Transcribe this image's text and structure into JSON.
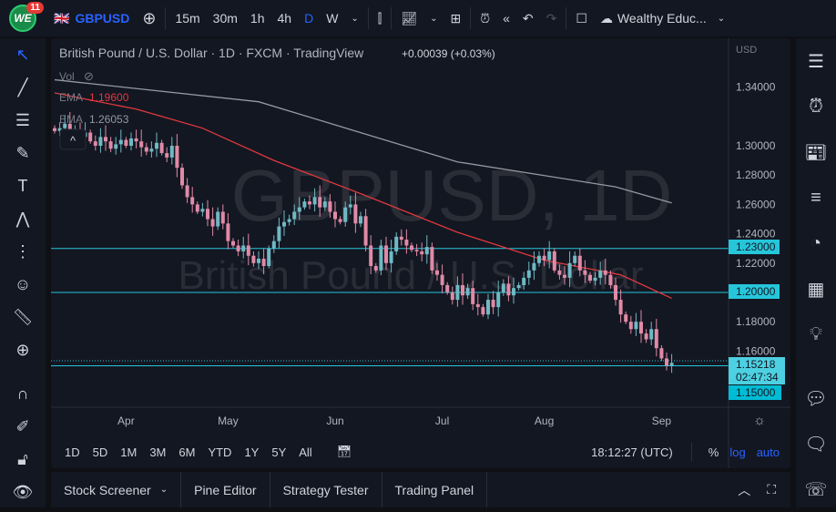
{
  "topbar": {
    "badge": "11",
    "logo": "WE",
    "symbol": "GBPUSD",
    "intervals": [
      "15m",
      "30m",
      "1h",
      "4h",
      "D",
      "W"
    ],
    "active_interval": "D",
    "account": "Wealthy Educ..."
  },
  "legend": {
    "title": "British Pound / U.S. Dollar · 1D · FXCM · TradingView",
    "change": "+0.00039 (+0.03%)",
    "vol": "Vol",
    "ema1_label": "EMA",
    "ema1_value": "1.19600",
    "ema2_label": "EMA",
    "ema2_value": "1.26053"
  },
  "watermark": {
    "line1": "GBPUSD, 1D",
    "line2": "British Pound / U.S. Dollar"
  },
  "price_axis": {
    "currency": "USD",
    "ticks": [
      "1.34000",
      "1.30000",
      "1.28000",
      "1.26000",
      "1.24000",
      "1.22000",
      "1.18000",
      "1.16000"
    ],
    "labels": {
      "line_1": "1.23000",
      "line_2": "1.20000",
      "price": "1.15218",
      "countdown": "02:47:34",
      "line_3": "1.15000"
    }
  },
  "time_axis": {
    "labels": [
      "Apr",
      "May",
      "Jun",
      "Jul",
      "Aug",
      "Sep"
    ]
  },
  "range_bar": {
    "ranges": [
      "1D",
      "5D",
      "1M",
      "3M",
      "6M",
      "YTD",
      "1Y",
      "5Y",
      "All"
    ],
    "clock": "18:12:27 (UTC)",
    "percent": "%",
    "log": "log",
    "auto": "auto"
  },
  "bottom_tabs": [
    "Stock Screener",
    "Pine Editor",
    "Strategy Tester",
    "Trading Panel"
  ],
  "colors": {
    "up": "#6fb9c4",
    "down": "#e08aa6",
    "ema_fast": "#e0393e",
    "ema_slow": "#9598a1",
    "hline": "#26c6da",
    "accent": "#2962ff"
  },
  "chart_data": {
    "type": "candlestick",
    "symbol": "GBPUSD",
    "timeframe": "1D",
    "yrange": [
      1.14,
      1.355
    ],
    "closes": [
      1.31,
      1.312,
      1.315,
      1.308,
      1.311,
      1.306,
      1.309,
      1.303,
      1.3,
      1.306,
      1.303,
      1.298,
      1.301,
      1.304,
      1.3,
      1.305,
      1.303,
      1.299,
      1.296,
      1.298,
      1.302,
      1.295,
      1.292,
      1.3,
      1.285,
      1.273,
      1.265,
      1.26,
      1.255,
      1.257,
      1.25,
      1.245,
      1.255,
      1.247,
      1.235,
      1.232,
      1.228,
      1.232,
      1.225,
      1.22,
      1.223,
      1.218,
      1.23,
      1.235,
      1.245,
      1.248,
      1.25,
      1.255,
      1.258,
      1.262,
      1.26,
      1.265,
      1.258,
      1.262,
      1.255,
      1.25,
      1.248,
      1.258,
      1.26,
      1.247,
      1.252,
      1.232,
      1.218,
      1.215,
      1.232,
      1.22,
      1.228,
      1.238,
      1.236,
      1.232,
      1.229,
      1.228,
      1.226,
      1.231,
      1.215,
      1.212,
      1.205,
      1.2,
      1.195,
      1.205,
      1.198,
      1.203,
      1.192,
      1.19,
      1.185,
      1.195,
      1.19,
      1.2,
      1.206,
      1.198,
      1.203,
      1.205,
      1.21,
      1.215,
      1.22,
      1.225,
      1.222,
      1.228,
      1.215,
      1.212,
      1.21,
      1.22,
      1.225,
      1.215,
      1.212,
      1.208,
      1.21,
      1.215,
      1.212,
      1.205,
      1.195,
      1.185,
      1.18,
      1.175,
      1.18,
      1.172,
      1.168,
      1.175,
      1.162,
      1.155,
      1.15,
      1.152
    ],
    "month_start_index": {
      "Apr": 14,
      "May": 34,
      "Jun": 55,
      "Jul": 76,
      "Aug": 96,
      "Sep": 119
    },
    "ema_fast": [
      [
        0,
        1.336
      ],
      [
        16,
        1.325
      ],
      [
        29,
        1.312
      ],
      [
        43,
        1.29
      ],
      [
        61,
        1.266
      ],
      [
        79,
        1.241
      ],
      [
        96,
        1.222
      ],
      [
        111,
        1.212
      ],
      [
        121,
        1.196
      ]
    ],
    "ema_slow": [
      [
        0,
        1.345
      ],
      [
        40,
        1.33
      ],
      [
        79,
        1.289
      ],
      [
        110,
        1.272
      ],
      [
        121,
        1.261
      ]
    ],
    "hlines": [
      1.23,
      1.2,
      1.15
    ],
    "last_price": 1.15218
  }
}
